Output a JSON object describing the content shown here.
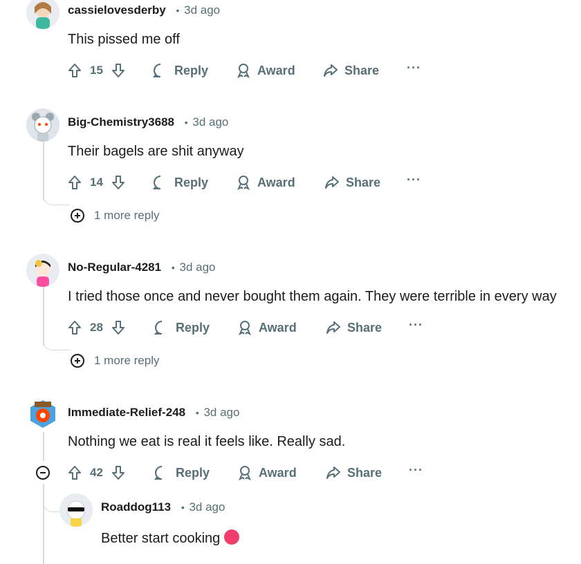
{
  "comments": [
    {
      "user": "cassielovesderby",
      "time": "3d ago",
      "text": "This pissed me off",
      "score": "15",
      "reply": "Reply",
      "award": "Award",
      "share": "Share",
      "more": "···"
    },
    {
      "user": "Big-Chemistry3688",
      "time": "3d ago",
      "text": "Their bagels are shit anyway",
      "score": "14",
      "reply": "Reply",
      "award": "Award",
      "share": "Share",
      "more": "···",
      "more_replies": "1 more reply"
    },
    {
      "user": "No-Regular-4281",
      "time": "3d ago",
      "text": "I tried those once and never bought them again. They were terrible in every way",
      "score": "28",
      "reply": "Reply",
      "award": "Award",
      "share": "Share",
      "more": "···",
      "more_replies": "1 more reply"
    },
    {
      "user": "Immediate-Relief-248",
      "time": "3d ago",
      "text": "Nothing we eat is real it feels like. Really sad.",
      "score": "42",
      "reply": "Reply",
      "award": "Award",
      "share": "Share",
      "more": "···"
    },
    {
      "user": "Roaddog113",
      "time": "3d ago",
      "text": "Better start cooking"
    }
  ],
  "separator": "•",
  "icons": {
    "upvote": "upvote-arrow-icon",
    "downvote": "downvote-arrow-icon",
    "reply": "speech-bubble-icon",
    "award": "award-ribbon-icon",
    "share": "share-arrow-icon",
    "collapse": "collapse-minus-icon",
    "expand": "expand-plus-icon",
    "emoji": "tongue-out-emoji"
  },
  "colors": {
    "meta": "#576f76",
    "text": "#1c1c1c",
    "line": "#d5dadd"
  }
}
